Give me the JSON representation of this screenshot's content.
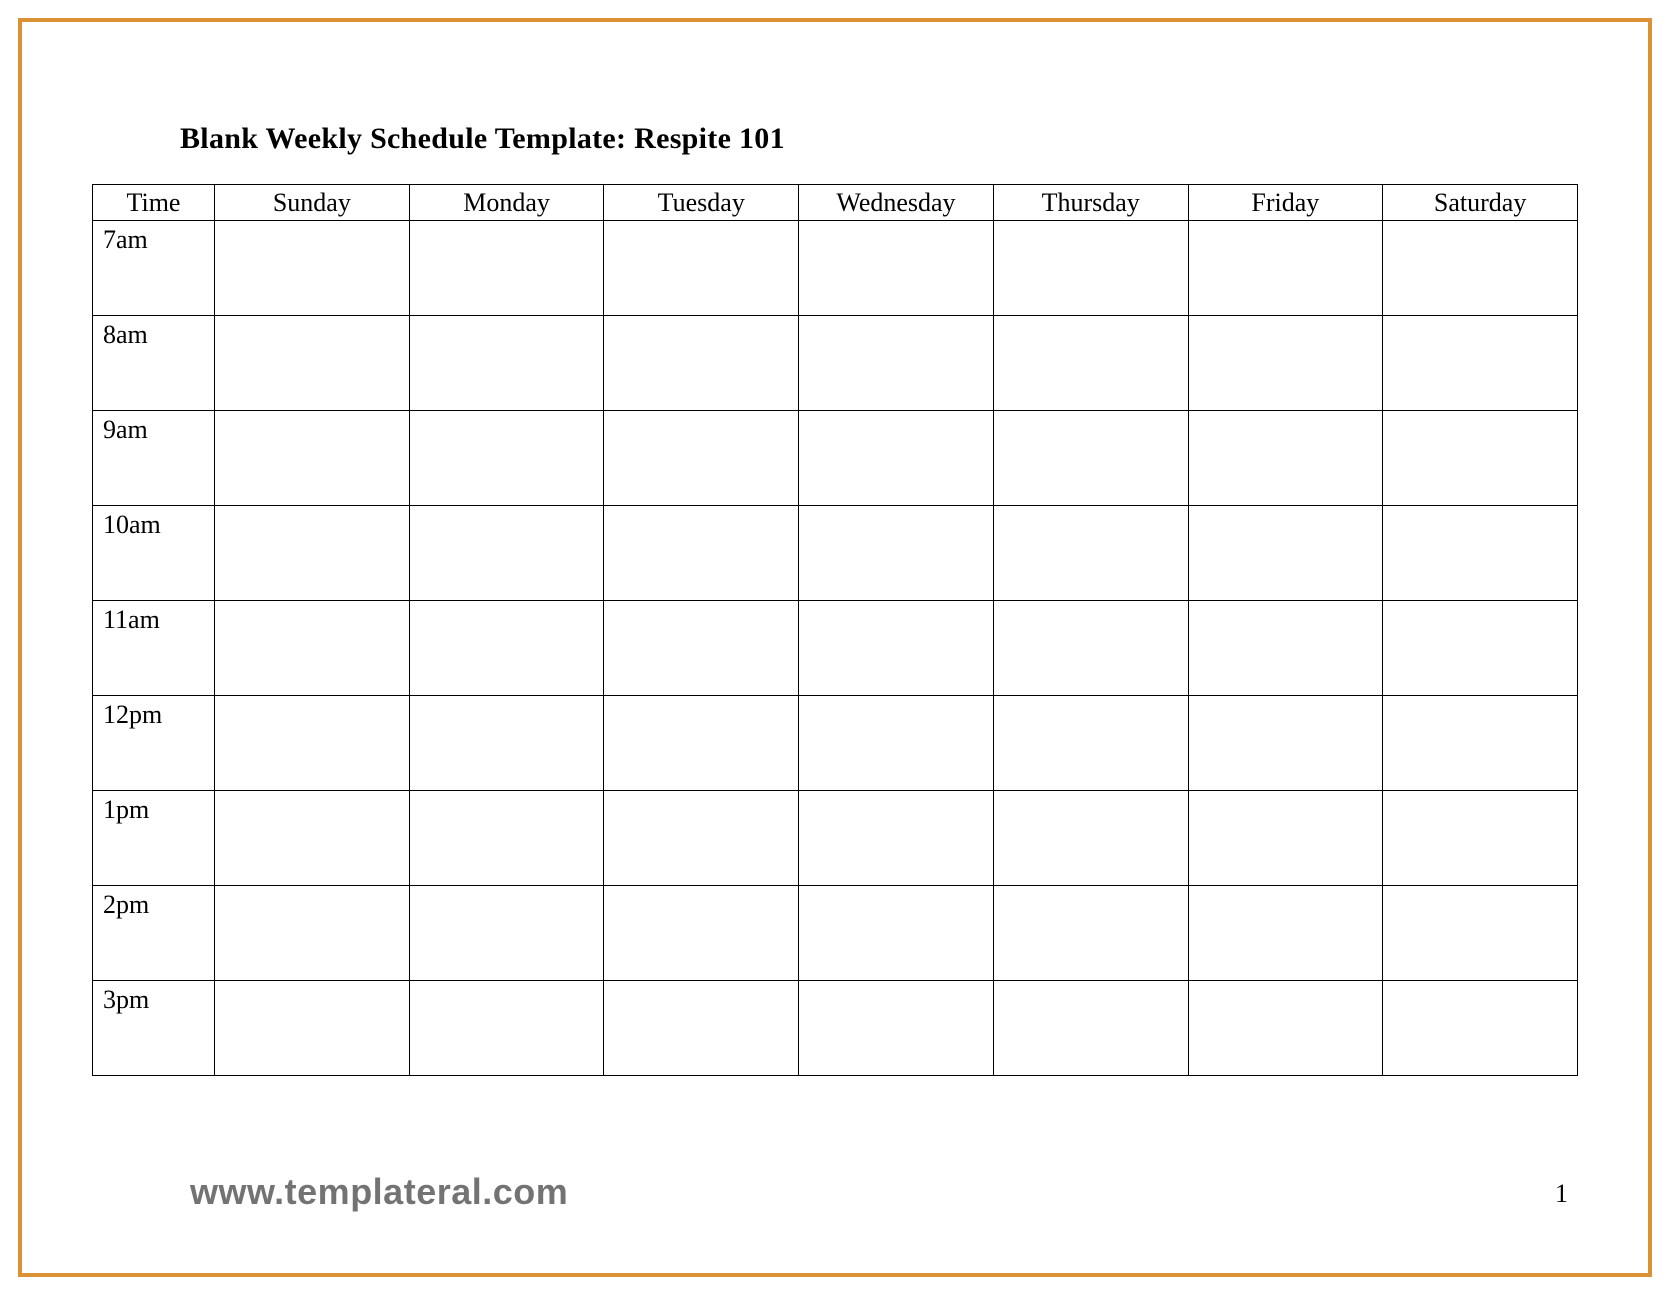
{
  "title": "Blank Weekly Schedule Template: Respite 101",
  "columns": {
    "time": "Time",
    "days": [
      "Sunday",
      "Monday",
      "Tuesday",
      "Wednesday",
      "Thursday",
      "Friday",
      "Saturday"
    ]
  },
  "times": [
    "7am",
    "8am",
    "9am",
    "10am",
    "11am",
    "12pm",
    "1pm",
    "2pm",
    "3pm"
  ],
  "watermark": "www.templateral.com",
  "page_number": "1"
}
